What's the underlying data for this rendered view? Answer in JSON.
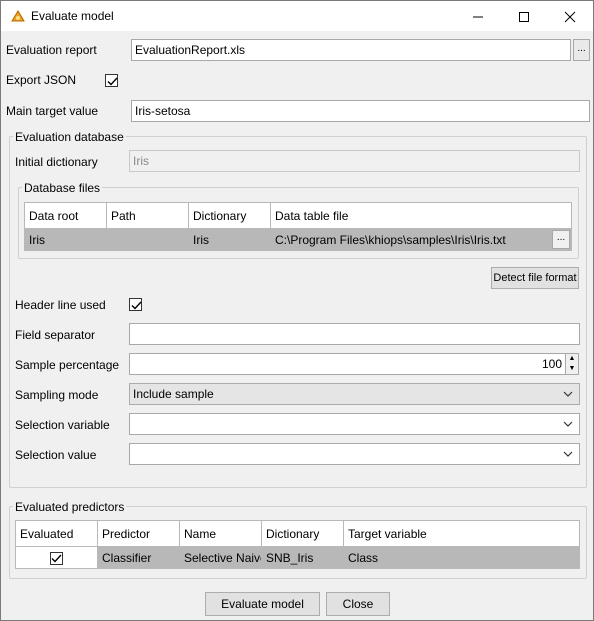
{
  "window": {
    "title": "Evaluate model"
  },
  "form": {
    "evaluation_report_label": "Evaluation report",
    "evaluation_report_value": "EvaluationReport.xls",
    "export_json_label": "Export JSON",
    "export_json_checked": true,
    "main_target_label": "Main target value",
    "main_target_value": "Iris-setosa"
  },
  "evaluation_database": {
    "title": "Evaluation database",
    "initial_dictionary_label": "Initial dictionary",
    "initial_dictionary_value": "Iris",
    "database_files": {
      "title": "Database files",
      "columns": [
        "Data root",
        "Path",
        "Dictionary",
        "Data table file"
      ],
      "rows": [
        {
          "data_root": "Iris",
          "path": "",
          "dictionary": "Iris",
          "data_table_file": "C:\\Program Files\\khiops\\samples\\Iris\\Iris.txt"
        }
      ]
    },
    "detect_button": "Detect file format",
    "header_line_label": "Header line used",
    "header_line_checked": true,
    "field_separator_label": "Field separator",
    "field_separator_value": "",
    "sample_percentage_label": "Sample percentage",
    "sample_percentage_value": "100",
    "sampling_mode_label": "Sampling mode",
    "sampling_mode_value": "Include sample",
    "selection_variable_label": "Selection variable",
    "selection_variable_value": "",
    "selection_value_label": "Selection value",
    "selection_value_value": ""
  },
  "evaluated_predictors": {
    "title": "Evaluated predictors",
    "columns": [
      "Evaluated",
      "Predictor",
      "Name",
      "Dictionary",
      "Target variable"
    ],
    "rows": [
      {
        "evaluated": true,
        "predictor": "Classifier",
        "name": "Selective Naive Bayes",
        "dictionary": "SNB_Iris",
        "target_variable": "Class"
      }
    ]
  },
  "footer": {
    "evaluate_button": "Evaluate model",
    "close_button": "Close"
  },
  "colors": {
    "window_bg": "#f0f0f0",
    "selected_row_bg": "#b8b8b8",
    "accent_icon": "#f0a020"
  }
}
